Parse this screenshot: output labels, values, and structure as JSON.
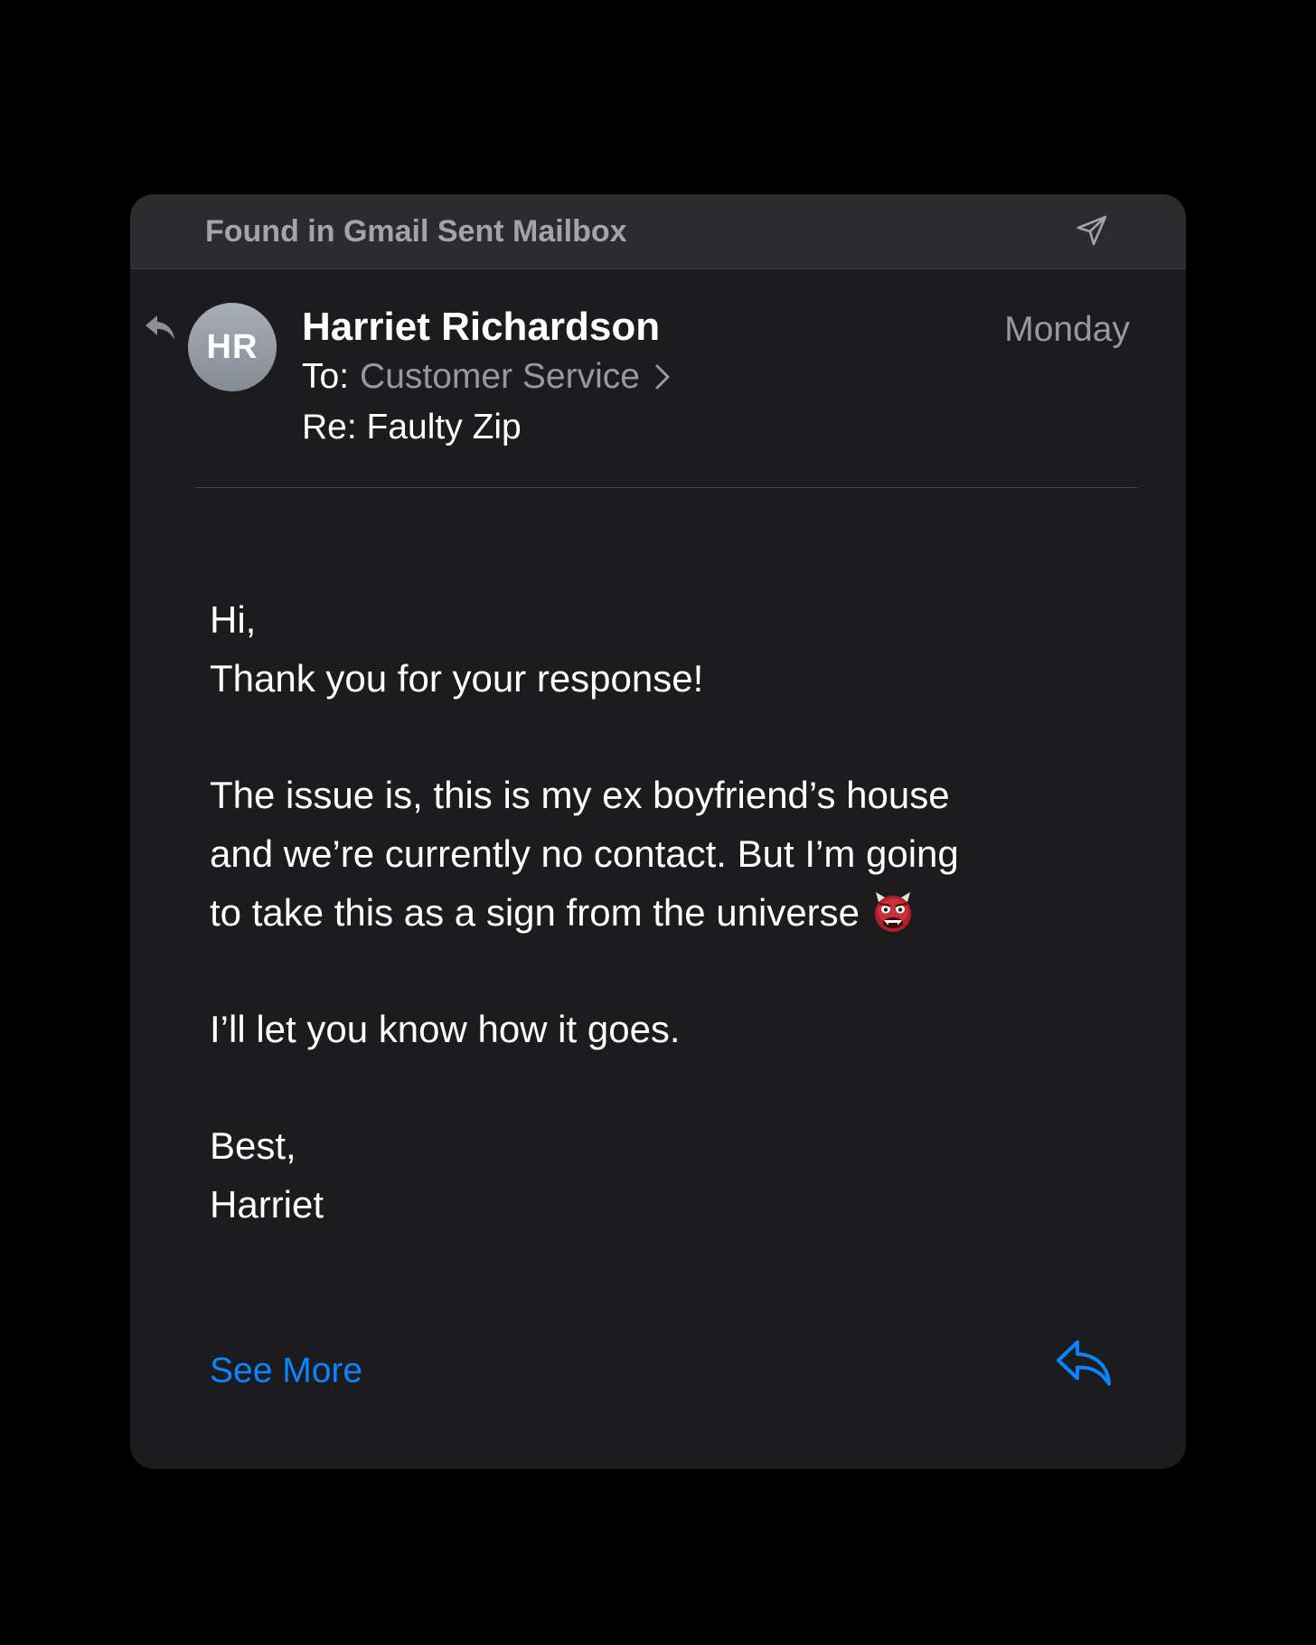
{
  "header": {
    "title": "Found in Gmail Sent Mailbox",
    "icon": "paper-plane-icon"
  },
  "message": {
    "sender_initials": "HR",
    "sender_name": "Harriet Richardson",
    "date": "Monday",
    "to_label": "To:",
    "to_recipient": "Customer Service",
    "subject": "Re: Faulty Zip",
    "replied_icon": "reply-arrow-icon"
  },
  "body": {
    "greeting": "Hi,",
    "line_thanks": "Thank you for your response!",
    "paragraph1_line1": "The issue is, this is my ex boyfriend’s house",
    "paragraph1_line2": "and we’re currently no contact. But I’m going",
    "paragraph1_line3": "to take this as a sign from the universe",
    "emoji": "ogre-emoji",
    "paragraph2": "I’ll let you know how it goes.",
    "signoff": "Best,",
    "signature": "Harriet"
  },
  "footer": {
    "see_more": "See More",
    "reply_icon": "reply-icon"
  },
  "colors": {
    "background": "#000000",
    "card": "#1c1c1e",
    "header": "#2c2c2e",
    "accent": "#0a84ff",
    "secondary_text": "#98989d"
  }
}
